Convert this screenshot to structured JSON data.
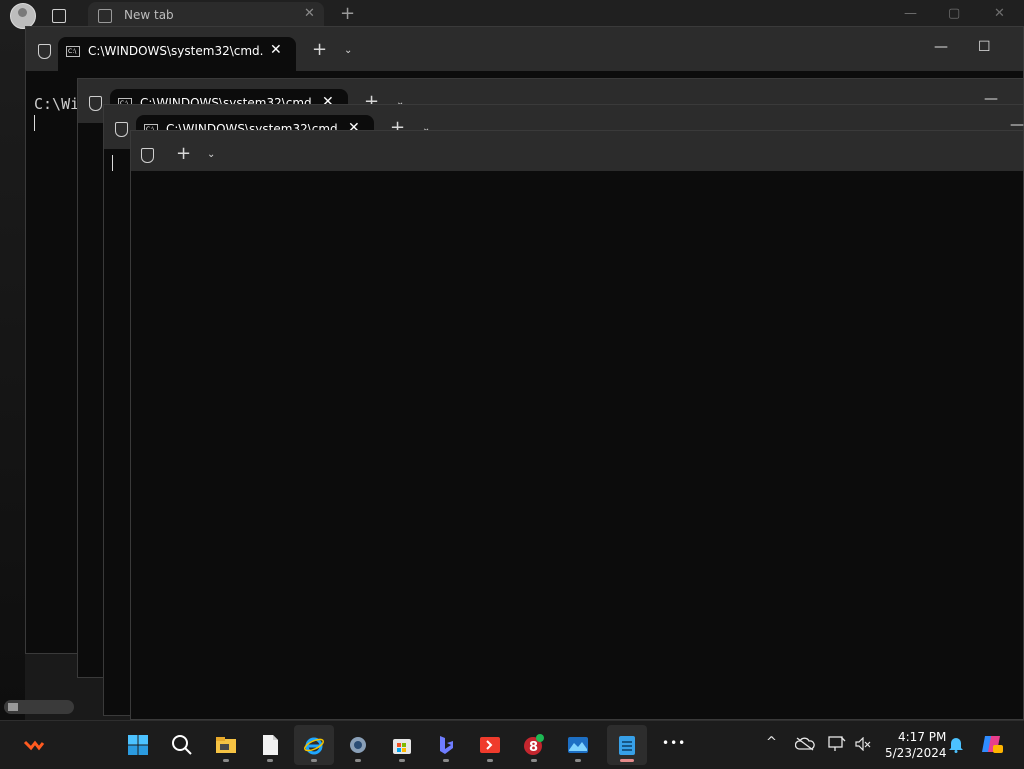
{
  "browser": {
    "tab_label": "New tab",
    "new_tab_symbol": "+",
    "close_symbol": "✕",
    "controls": [
      "—",
      "▢",
      "✕"
    ]
  },
  "terminals": [
    {
      "tab_title": "C:\\WINDOWS\\system32\\cmd.",
      "prompt": "C:\\Wi"
    },
    {
      "tab_title": "C:\\WINDOWS\\system32\\cmd"
    },
    {
      "tab_title": "C:\\WINDOWS\\system32\\cmd"
    }
  ],
  "terminal_common": {
    "new_tab_symbol": "+",
    "dropdown_symbol": "⌄",
    "close_symbol": "✕",
    "minimize_symbol": "—",
    "maximize_symbol": "☐",
    "cmd_icon_text": "C:\\"
  },
  "taskbar": {
    "apps": [
      {
        "name": "app-orange-icon"
      },
      {
        "name": "start-icon"
      },
      {
        "name": "search-icon"
      },
      {
        "name": "file-explorer-icon"
      },
      {
        "name": "notepad-file-icon"
      },
      {
        "name": "internet-explorer-icon"
      },
      {
        "name": "settings-icon"
      },
      {
        "name": "store-icon"
      },
      {
        "name": "bing-icon"
      },
      {
        "name": "anydesk-icon"
      },
      {
        "name": "app-8-icon"
      },
      {
        "name": "photos-icon"
      },
      {
        "name": "notepad-icon"
      },
      {
        "name": "more-icon"
      }
    ],
    "more_symbol": "•••",
    "tray": {
      "chevron": "^",
      "time": "4:17 PM",
      "date": "5/23/2024"
    }
  },
  "colors": {
    "terminal_bg": "#0c0c0c",
    "titlebar_bg": "#2c2c2c",
    "taskbar_bg": "#1c1c1c",
    "accent_windows": "#0078d4"
  }
}
